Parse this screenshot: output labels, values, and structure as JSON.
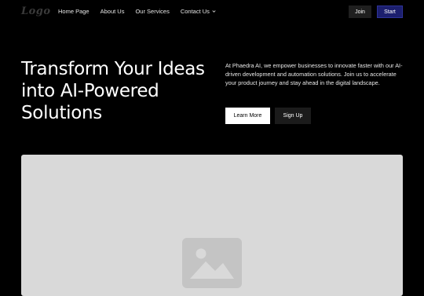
{
  "nav": {
    "logo": "Logo",
    "links": [
      "Home Page",
      "About Us",
      "Our Services",
      "Contact Us"
    ],
    "join_label": "Join",
    "start_label": "Start"
  },
  "hero": {
    "headline": "Transform Your Ideas into AI-Powered Solutions",
    "description": "At Phaedra AI, we empower businesses to innovate faster with our AI-driven development and automation solutions. Join us to accelerate your product journey and stay ahead in the digital landscape.",
    "learn_more_label": "Learn More",
    "sign_up_label": "Sign Up"
  },
  "media": {
    "icon": "image-placeholder-icon"
  },
  "colors": {
    "background": "#000000",
    "start_button": "#1c1f6e",
    "media_placeholder": "#d9d9d9"
  }
}
